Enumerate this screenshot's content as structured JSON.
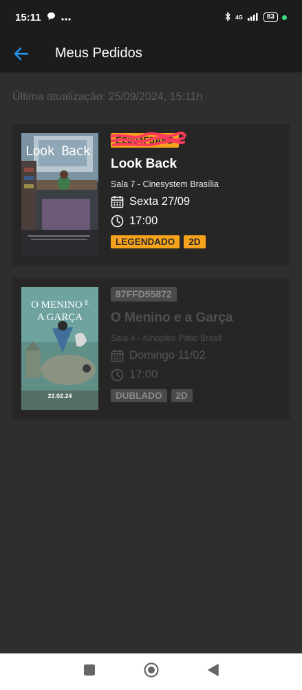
{
  "status_bar": {
    "time": "15:11",
    "network": "4G",
    "battery": "83"
  },
  "app_bar": {
    "title": "Meus Pedidos"
  },
  "last_update": "Última atualização: 25/09/2024, 15:11h",
  "orders": [
    {
      "code": "E2304F5A6D",
      "code_redacted": true,
      "title": "Look Back",
      "poster_title": "Look Back",
      "room": "Sala 7 - Cinesystem Brasília",
      "date": "Sexta 27/09",
      "time": "17:00",
      "tags": [
        "LEGENDADO",
        "2D"
      ],
      "active": true
    },
    {
      "code": "87FFD55872",
      "title": "O Menino e a Garça",
      "poster_title_1": "O MENINO",
      "poster_title_e": "E",
      "poster_title_2": "A GARÇA",
      "poster_date": "22.02.24",
      "room": "Sala 4 - Kinoplex Pátio Brasil",
      "date": "Domingo 11/02",
      "time": "17:00",
      "tags": [
        "DUBLADO",
        "2D"
      ],
      "active": false
    }
  ],
  "colors": {
    "accent": "#f7a21b",
    "back_arrow": "#2196f3",
    "background": "#2e2e2e",
    "card": "#262626"
  }
}
